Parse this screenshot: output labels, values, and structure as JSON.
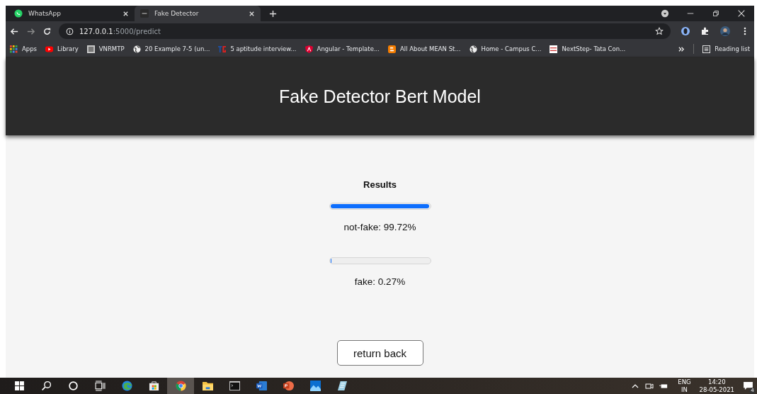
{
  "tabs": [
    {
      "label": "WhatsApp",
      "kind": "whatsapp",
      "selected": false
    },
    {
      "label": "Fake Detector",
      "kind": "fd",
      "selected": true
    }
  ],
  "address": {
    "host": "127.0.0.1",
    "path": ":5000/predict"
  },
  "bookmarks": [
    {
      "label": "Apps",
      "kind": "apps"
    },
    {
      "label": "Library",
      "kind": "youtube"
    },
    {
      "label": "VNRMTP",
      "kind": "image"
    },
    {
      "label": "20 Example 7-5 (un...",
      "kind": "globe"
    },
    {
      "label": "5 aptitude interview...",
      "kind": "tg"
    },
    {
      "label": "Angular - Template...",
      "kind": "angular"
    },
    {
      "label": "All About MEAN St...",
      "kind": "blogger"
    },
    {
      "label": "Home - Campus C...",
      "kind": "globe"
    },
    {
      "label": "NextStep- Tata Con...",
      "kind": "tcs"
    }
  ],
  "reading_list": "Reading list",
  "page": {
    "title": "Fake Detector Bert Model",
    "results_heading": "Results",
    "results": [
      {
        "label": "not-fake: 99.72%",
        "level": 0.9972
      },
      {
        "label": "fake: 0.27%",
        "level": 0.0027
      }
    ],
    "button": "return back"
  },
  "taskbar": {
    "apps": [
      {
        "kind": "windows",
        "selected": false
      },
      {
        "kind": "search",
        "selected": false
      },
      {
        "kind": "cortana",
        "selected": false
      },
      {
        "kind": "taskview",
        "selected": false
      },
      {
        "kind": "edge",
        "selected": false
      },
      {
        "kind": "store",
        "selected": false
      },
      {
        "kind": "chrome",
        "selected": true
      },
      {
        "kind": "folder",
        "selected": false
      },
      {
        "kind": "terminal",
        "selected": false
      },
      {
        "kind": "word",
        "selected": false
      },
      {
        "kind": "powerpoint",
        "selected": false
      },
      {
        "kind": "photos",
        "selected": false
      },
      {
        "kind": "notepad",
        "selected": false
      }
    ],
    "language": "ENG",
    "region": "IN",
    "time": "14:20",
    "date": "28-05-2021",
    "notifications": "4"
  }
}
